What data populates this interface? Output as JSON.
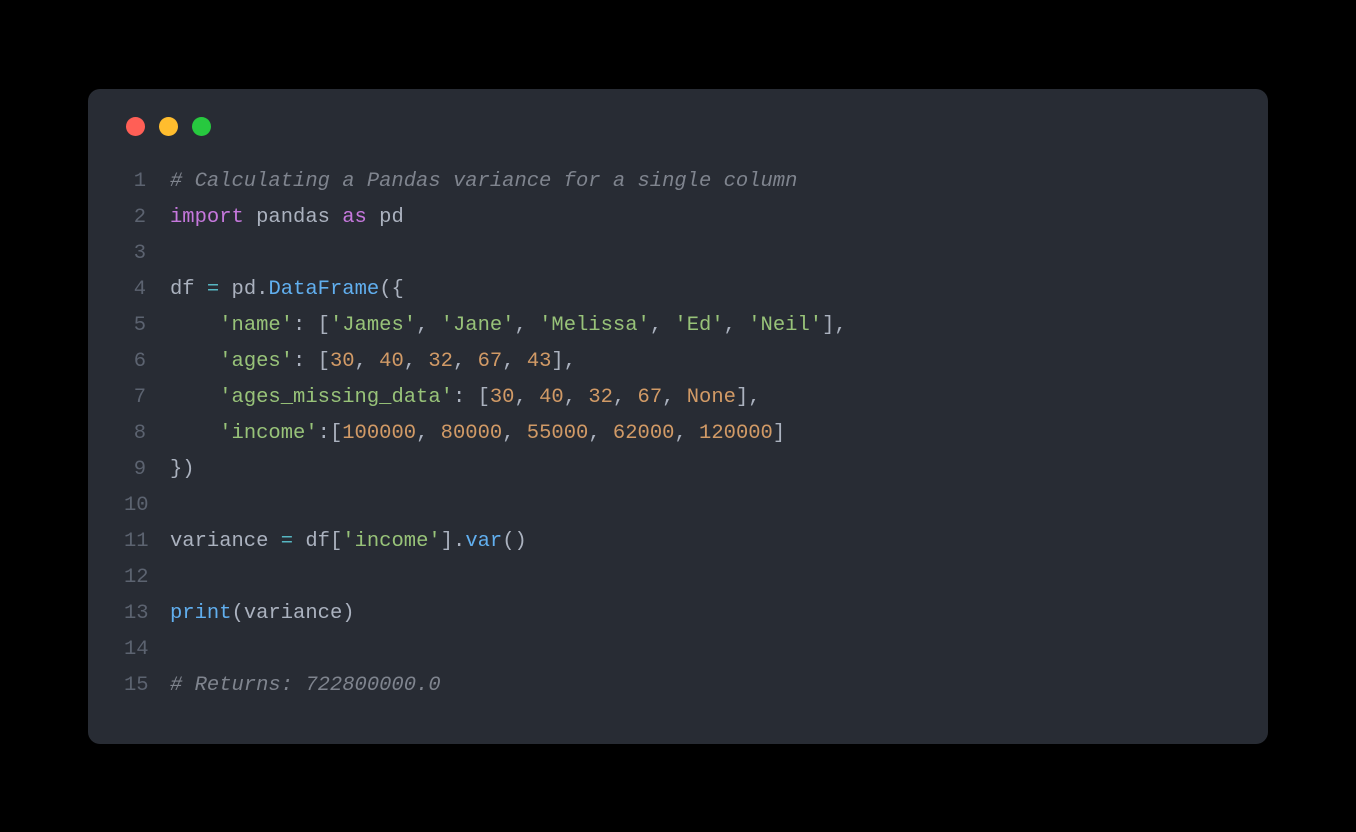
{
  "lineNumbers": [
    "1",
    "2",
    "3",
    "4",
    "5",
    "6",
    "7",
    "8",
    "9",
    "10",
    "11",
    "12",
    "13",
    "14",
    "15"
  ],
  "tokens": {
    "l1": {
      "comment": "# Calculating a Pandas variance for a single column"
    },
    "l2": {
      "import": "import",
      "sp1": " ",
      "pandas": "pandas",
      "sp2": " ",
      "as": "as",
      "sp3": " ",
      "pd": "pd"
    },
    "l4": {
      "df": "df",
      "sp1": " ",
      "eq": "=",
      "sp2": " ",
      "pd": "pd",
      "dot": ".",
      "DataFrame": "DataFrame",
      "open": "({"
    },
    "l5": {
      "indent": "    ",
      "key": "'name'",
      "colon": ": [",
      "v1": "'James'",
      "c1": ", ",
      "v2": "'Jane'",
      "c2": ", ",
      "v3": "'Melissa'",
      "c3": ", ",
      "v4": "'Ed'",
      "c4": ", ",
      "v5": "'Neil'",
      "close": "],"
    },
    "l6": {
      "indent": "    ",
      "key": "'ages'",
      "colon": ": [",
      "v1": "30",
      "c1": ", ",
      "v2": "40",
      "c2": ", ",
      "v3": "32",
      "c3": ", ",
      "v4": "67",
      "c4": ", ",
      "v5": "43",
      "close": "],"
    },
    "l7": {
      "indent": "    ",
      "key": "'ages_missing_data'",
      "colon": ": [",
      "v1": "30",
      "c1": ", ",
      "v2": "40",
      "c2": ", ",
      "v3": "32",
      "c3": ", ",
      "v4": "67",
      "c4": ", ",
      "v5": "None",
      "close": "],"
    },
    "l8": {
      "indent": "    ",
      "key": "'income'",
      "colon": ":[",
      "v1": "100000",
      "c1": ", ",
      "v2": "80000",
      "c2": ", ",
      "v3": "55000",
      "c3": ", ",
      "v4": "62000",
      "c4": ", ",
      "v5": "120000",
      "close": "]"
    },
    "l9": {
      "close": "})"
    },
    "l11": {
      "variance": "variance",
      "sp1": " ",
      "eq": "=",
      "sp2": " ",
      "df": "df",
      "open": "[",
      "key": "'income'",
      "close": "].",
      "var": "var",
      "paren": "()"
    },
    "l13": {
      "print": "print",
      "open": "(",
      "arg": "variance",
      "close": ")"
    },
    "l15": {
      "comment": "# Returns: 722800000.0"
    }
  },
  "colors": {
    "bg": "#282c34",
    "red": "#ff5f56",
    "yellow": "#ffbd2e",
    "green": "#27c93f"
  }
}
